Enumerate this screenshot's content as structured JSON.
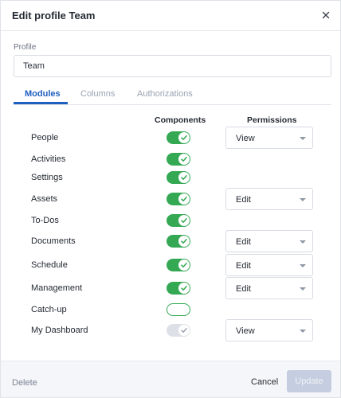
{
  "dialog": {
    "title": "Edit profile Team",
    "close_icon": "close-icon"
  },
  "profile": {
    "label": "Profile",
    "value": "Team"
  },
  "tabs": [
    {
      "label": "Modules",
      "active": true
    },
    {
      "label": "Columns",
      "active": false
    },
    {
      "label": "Authorizations",
      "active": false
    }
  ],
  "columns": {
    "components": "Components",
    "permissions": "Permissions"
  },
  "modules": [
    {
      "label": "People",
      "component": "on",
      "permission": "View"
    },
    {
      "label": "Activities",
      "component": "on",
      "permission": null
    },
    {
      "label": "Settings",
      "component": "on",
      "permission": null
    },
    {
      "label": "Assets",
      "component": "on",
      "permission": "Edit"
    },
    {
      "label": "To-Dos",
      "component": "on",
      "permission": null
    },
    {
      "label": "Documents",
      "component": "on",
      "permission": "Edit"
    },
    {
      "label": "Schedule",
      "component": "on",
      "permission": "Edit"
    },
    {
      "label": "Management",
      "component": "on",
      "permission": "Edit"
    },
    {
      "label": "Catch-up",
      "component": "off",
      "permission": null
    },
    {
      "label": "My Dashboard",
      "component": "disabled",
      "permission": "View"
    }
  ],
  "footer": {
    "delete_label": "Delete",
    "cancel_label": "Cancel",
    "update_label": "Update"
  },
  "colors": {
    "accent": "#1f5fbf",
    "toggle_on": "#34a853",
    "toggle_disabled": "#dde1e7",
    "update_disabled": "#c5cee0"
  }
}
